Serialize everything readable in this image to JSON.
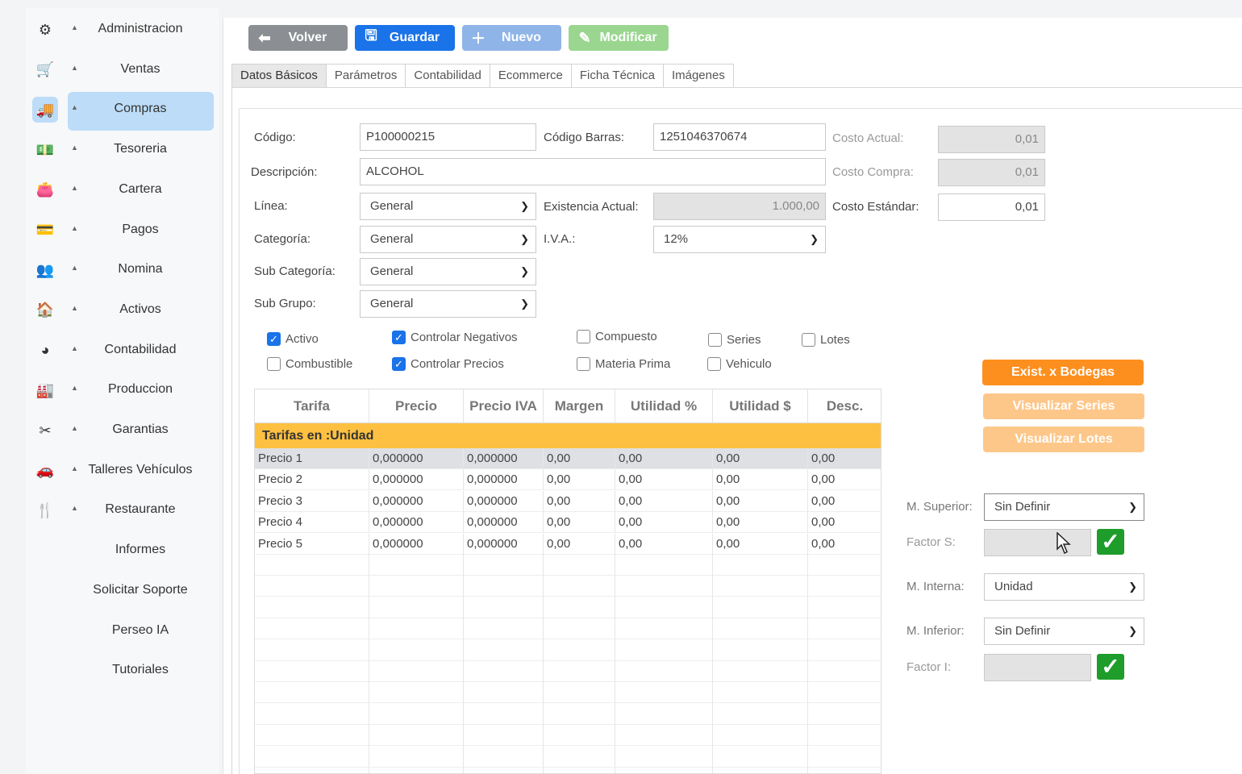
{
  "sidebar": {
    "items": [
      {
        "label": "Administracion",
        "icon": "gears-icon",
        "glyph": "⚙",
        "caret": true
      },
      {
        "label": "Ventas",
        "icon": "cart-icon",
        "glyph": "🛒",
        "caret": true
      },
      {
        "label": "Compras",
        "icon": "truck-icon",
        "glyph": "🚚",
        "caret": true,
        "active": true
      },
      {
        "label": "Tesoreria",
        "icon": "money-icon",
        "glyph": "💵",
        "caret": true
      },
      {
        "label": "Cartera",
        "icon": "wallet-icon",
        "glyph": "👛",
        "caret": true
      },
      {
        "label": "Pagos",
        "icon": "payments-icon",
        "glyph": "💳",
        "caret": true
      },
      {
        "label": "Nomina",
        "icon": "people-icon",
        "glyph": "👥",
        "caret": true
      },
      {
        "label": "Activos",
        "icon": "house-icon",
        "glyph": "🏠",
        "caret": true
      },
      {
        "label": "Contabilidad",
        "icon": "pie-chart-icon",
        "glyph": "◕",
        "caret": true
      },
      {
        "label": "Produccion",
        "icon": "factory-icon",
        "glyph": "🏭",
        "caret": true
      },
      {
        "label": "Garantias",
        "icon": "tools-icon",
        "glyph": "✂",
        "caret": true
      },
      {
        "label": "Talleres Vehículos",
        "icon": "car-icon",
        "glyph": "🚗",
        "caret": true
      },
      {
        "label": "Restaurante",
        "icon": "cutlery-icon",
        "glyph": "🍴",
        "caret": true
      },
      {
        "label": "Informes",
        "caret": false
      },
      {
        "label": "Solicitar Soporte",
        "caret": false
      },
      {
        "label": "Perseo IA",
        "caret": false
      },
      {
        "label": "Tutoriales",
        "caret": false
      }
    ]
  },
  "toolbar": {
    "back_label": "Volver",
    "save_label": "Guardar",
    "new_label": "Nuevo",
    "modify_label": "Modificar"
  },
  "tabs": [
    "Datos Básicos",
    "Parámetros",
    "Contabilidad",
    "Ecommerce",
    "Ficha Técnica",
    "Imágenes"
  ],
  "form": {
    "codigo_label": "Código:",
    "codigo_value": "P100000215",
    "codigo_barras_label": "Código Barras:",
    "codigo_barras_value": "1251046370674",
    "costo_actual_label": "Costo Actual:",
    "costo_actual_value": "0,01",
    "descripcion_label": "Descripción:",
    "descripcion_value": "ALCOHOL",
    "costo_compra_label": "Costo Compra:",
    "costo_compra_value": "0,01",
    "linea_label": "Línea:",
    "linea_value": "General",
    "existencia_label": "Existencia Actual:",
    "existencia_value": "1.000,00",
    "costo_estandar_label": "Costo Estándar:",
    "costo_estandar_value": "0,01",
    "categoria_label": "Categoría:",
    "categoria_value": "General",
    "iva_label": "I.V.A.:",
    "iva_value": "12%",
    "subcategoria_label": "Sub Categoría:",
    "subcategoria_value": "General",
    "subgrupo_label": "Sub Grupo:",
    "subgrupo_value": "General"
  },
  "checkboxes": {
    "activo": {
      "label": "Activo",
      "checked": true
    },
    "combustible": {
      "label": "Combustible",
      "checked": false
    },
    "controlar_negativos": {
      "label": "Controlar Negativos",
      "checked": true
    },
    "controlar_precios": {
      "label": "Controlar Precios",
      "checked": true
    },
    "compuesto": {
      "label": "Compuesto",
      "checked": false
    },
    "materia_prima": {
      "label": "Materia Prima",
      "checked": false
    },
    "series": {
      "label": "Series",
      "checked": false
    },
    "vehiculo": {
      "label": "Vehiculo",
      "checked": false
    },
    "lotes": {
      "label": "Lotes",
      "checked": false
    }
  },
  "grid": {
    "columns": [
      "Tarifa",
      "Precio",
      "Precio IVA",
      "Margen",
      "Utilidad %",
      "Utilidad $",
      "Desc."
    ],
    "group_label": "Tarifas en :Unidad",
    "rows": [
      [
        "Precio 1",
        "0,000000",
        "0,000000",
        "0,00",
        "0,00",
        "0,00",
        "0,00"
      ],
      [
        "Precio 2",
        "0,000000",
        "0,000000",
        "0,00",
        "0,00",
        "0,00",
        "0,00"
      ],
      [
        "Precio 3",
        "0,000000",
        "0,000000",
        "0,00",
        "0,00",
        "0,00",
        "0,00"
      ],
      [
        "Precio 4",
        "0,000000",
        "0,000000",
        "0,00",
        "0,00",
        "0,00",
        "0,00"
      ],
      [
        "Precio 5",
        "0,000000",
        "0,000000",
        "0,00",
        "0,00",
        "0,00",
        "0,00"
      ]
    ]
  },
  "side_buttons": {
    "exist_bodegas": "Exist. x Bodegas",
    "visualizar_series": "Visualizar Series",
    "visualizar_lotes": "Visualizar Lotes"
  },
  "units": {
    "superior_label": "M. Superior:",
    "superior_value": "Sin Definir",
    "factor_s_label": "Factor S:",
    "interna_label": "M. Interna:",
    "interna_value": "Unidad",
    "inferior_label": "M. Inferior:",
    "inferior_value": "Sin Definir",
    "factor_i_label": "Factor I:"
  },
  "colors": {
    "primary": "#1a73e8",
    "disabled_blue": "#8fb4e8",
    "disabled_green": "#9ad68f",
    "back_gray": "#8b8f94",
    "orange": "#fd8f1f",
    "orange_light": "#fdc78a",
    "group_yellow": "#fdc040",
    "ok_green": "#1e9d2a"
  }
}
